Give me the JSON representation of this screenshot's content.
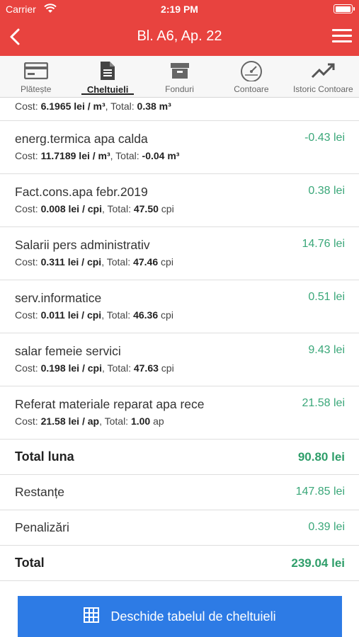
{
  "status_bar": {
    "carrier": "Carrier",
    "time": "2:19 PM",
    "battery_level": 1.0
  },
  "nav": {
    "title": "Bl. A6, Ap. 22",
    "back_icon": "chevron-left-icon",
    "menu_icon": "hamburger-menu-icon"
  },
  "tabs": [
    {
      "label": "Plătește",
      "icon": "credit-card-icon",
      "active": false
    },
    {
      "label": "Cheltuieli",
      "icon": "document-icon",
      "active": true
    },
    {
      "label": "Fonduri",
      "icon": "archive-box-icon",
      "active": false
    },
    {
      "label": "Contoare",
      "icon": "speedometer-icon",
      "active": false
    },
    {
      "label": "Istoric Contoare",
      "icon": "trending-up-icon",
      "active": false
    }
  ],
  "partial_row": {
    "cost_label": "Cost: ",
    "cost_value": "6.1965 lei / m³",
    "total_label": ", Total: ",
    "total_value": "0.38 m³"
  },
  "items": [
    {
      "name": "energ.termica apa calda",
      "cost_label": "Cost: ",
      "cost_value": "11.7189 lei / m³",
      "total_label": ", Total: ",
      "total_value": "-0.04 m³",
      "amount": "-0.43 lei"
    },
    {
      "name": "Fact.cons.apa febr.2019",
      "cost_label": "Cost: ",
      "cost_value": "0.008 lei / cpi",
      "total_label": ", Total: ",
      "total_value": "47.50",
      "total_unit": " cpi",
      "amount": "0.38 lei"
    },
    {
      "name": "Salarii pers administrativ",
      "cost_label": "Cost: ",
      "cost_value": "0.311 lei / cpi",
      "total_label": ", Total: ",
      "total_value": "47.46",
      "total_unit": " cpi",
      "amount": "14.76 lei"
    },
    {
      "name": "serv.informatice",
      "cost_label": "Cost: ",
      "cost_value": "0.011 lei / cpi",
      "total_label": ", Total: ",
      "total_value": "46.36",
      "total_unit": " cpi",
      "amount": "0.51 lei"
    },
    {
      "name": "salar femeie servici",
      "cost_label": "Cost: ",
      "cost_value": "0.198 lei / cpi",
      "total_label": ", Total: ",
      "total_value": "47.63",
      "total_unit": " cpi",
      "amount": "9.43 lei"
    },
    {
      "name": "Referat materiale reparat apa rece",
      "cost_label": "Cost: ",
      "cost_value": "21.58 lei / ap",
      "total_label": ", Total: ",
      "total_value": "1.00",
      "total_unit": " ap",
      "amount": "21.58 lei"
    }
  ],
  "summary": {
    "total_luna": {
      "label": "Total luna",
      "amount": "90.80 lei"
    },
    "restante": {
      "label": "Restanțe",
      "amount": "147.85 lei"
    },
    "penalizari": {
      "label": "Penalizări",
      "amount": "0.39 lei"
    },
    "total": {
      "label": "Total",
      "amount": "239.04 lei"
    }
  },
  "bottom_button": {
    "label": "Deschide tabelul de cheltuieli",
    "icon": "grid-table-icon"
  },
  "colors": {
    "brand_red": "#e8433f",
    "amount_green": "#3aa779",
    "button_blue": "#2d7be5"
  }
}
